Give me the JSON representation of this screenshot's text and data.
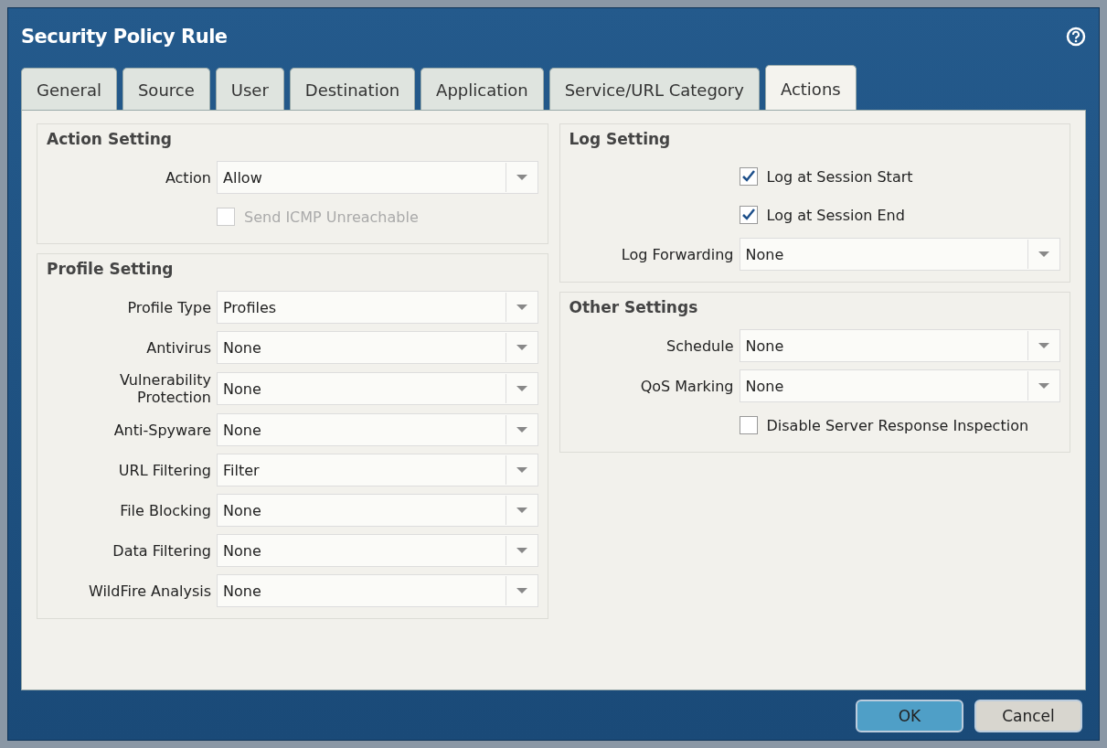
{
  "window": {
    "title": "Security Policy Rule"
  },
  "tabs": [
    {
      "label": "General",
      "selected": false
    },
    {
      "label": "Source",
      "selected": false
    },
    {
      "label": "User",
      "selected": false
    },
    {
      "label": "Destination",
      "selected": false
    },
    {
      "label": "Application",
      "selected": false
    },
    {
      "label": "Service/URL Category",
      "selected": false
    },
    {
      "label": "Actions",
      "selected": true
    }
  ],
  "left": [
    {
      "title": "Action Setting",
      "fields": [
        {
          "kind": "select",
          "label": "Action",
          "value": "Allow"
        },
        {
          "kind": "checkbox",
          "label": "Send ICMP Unreachable",
          "checked": false,
          "disabled": true
        }
      ]
    },
    {
      "title": "Profile Setting",
      "fields": [
        {
          "kind": "select",
          "label": "Profile Type",
          "value": "Profiles"
        },
        {
          "kind": "select",
          "label": "Antivirus",
          "value": "None"
        },
        {
          "kind": "select",
          "label": "Vulnerability Protection",
          "value": "None"
        },
        {
          "kind": "select",
          "label": "Anti-Spyware",
          "value": "None"
        },
        {
          "kind": "select",
          "label": "URL Filtering",
          "value": "Filter"
        },
        {
          "kind": "select",
          "label": "File Blocking",
          "value": "None"
        },
        {
          "kind": "select",
          "label": "Data Filtering",
          "value": "None"
        },
        {
          "kind": "select",
          "label": "WildFire Analysis",
          "value": "None"
        }
      ]
    }
  ],
  "right": [
    {
      "title": "Log Setting",
      "fields": [
        {
          "kind": "checkbox",
          "label": "Log at Session Start",
          "checked": true,
          "disabled": false
        },
        {
          "kind": "checkbox",
          "label": "Log at Session End",
          "checked": true,
          "disabled": false
        },
        {
          "kind": "select",
          "label": "Log Forwarding",
          "value": "None"
        }
      ]
    },
    {
      "title": "Other Settings",
      "fields": [
        {
          "kind": "select",
          "label": "Schedule",
          "value": "None"
        },
        {
          "kind": "select",
          "label": "QoS Marking",
          "value": "None"
        },
        {
          "kind": "checkbox",
          "label": "Disable Server Response Inspection",
          "checked": false,
          "disabled": false
        }
      ]
    }
  ],
  "buttons": [
    {
      "label": "OK",
      "primary": true
    },
    {
      "label": "Cancel",
      "primary": false
    }
  ]
}
